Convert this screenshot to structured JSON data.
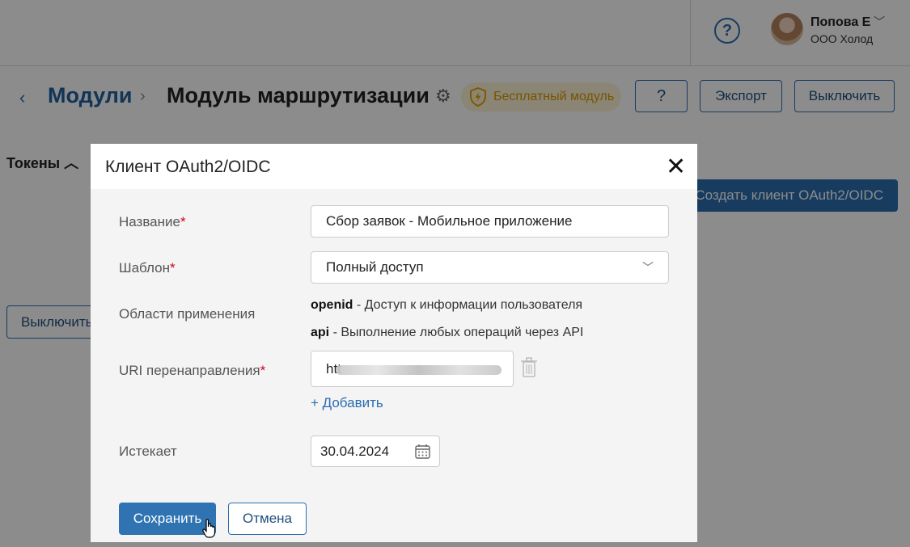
{
  "header": {
    "help_icon": "question-circle-icon",
    "user_name": "Попова Е",
    "user_org": "ООО Холод"
  },
  "page": {
    "breadcrumb_root": "Модули",
    "title": "Модуль маршрутизации с",
    "badge_label": "Бесплатный модуль",
    "export_label": "Экспорт",
    "disable_label": "Выключить",
    "tokens_label": "Токены",
    "create_client_label": "Создать клиент OAuth2/OIDC",
    "row_disable_label": "Выключить",
    "accent_color": "#2a6db0"
  },
  "modal": {
    "title": "Клиент OAuth2/OIDC",
    "name_label": "Название",
    "name_value": "Сбор заявок - Мобильное приложение",
    "template_label": "Шаблон",
    "template_value": "Полный доступ",
    "scopes_label": "Области применения",
    "scopes": [
      {
        "key": "openid",
        "desc": " - Доступ к информации пользователя"
      },
      {
        "key": "api",
        "desc": " - Выполнение любых операций через API"
      }
    ],
    "uri_label": "URI перенаправления",
    "uri_value_visible": "htt",
    "add_label": "+ Добавить",
    "expires_label": "Истекает",
    "expires_value": "30.04.2024",
    "save_label": "Сохранить",
    "cancel_label": "Отмена"
  }
}
